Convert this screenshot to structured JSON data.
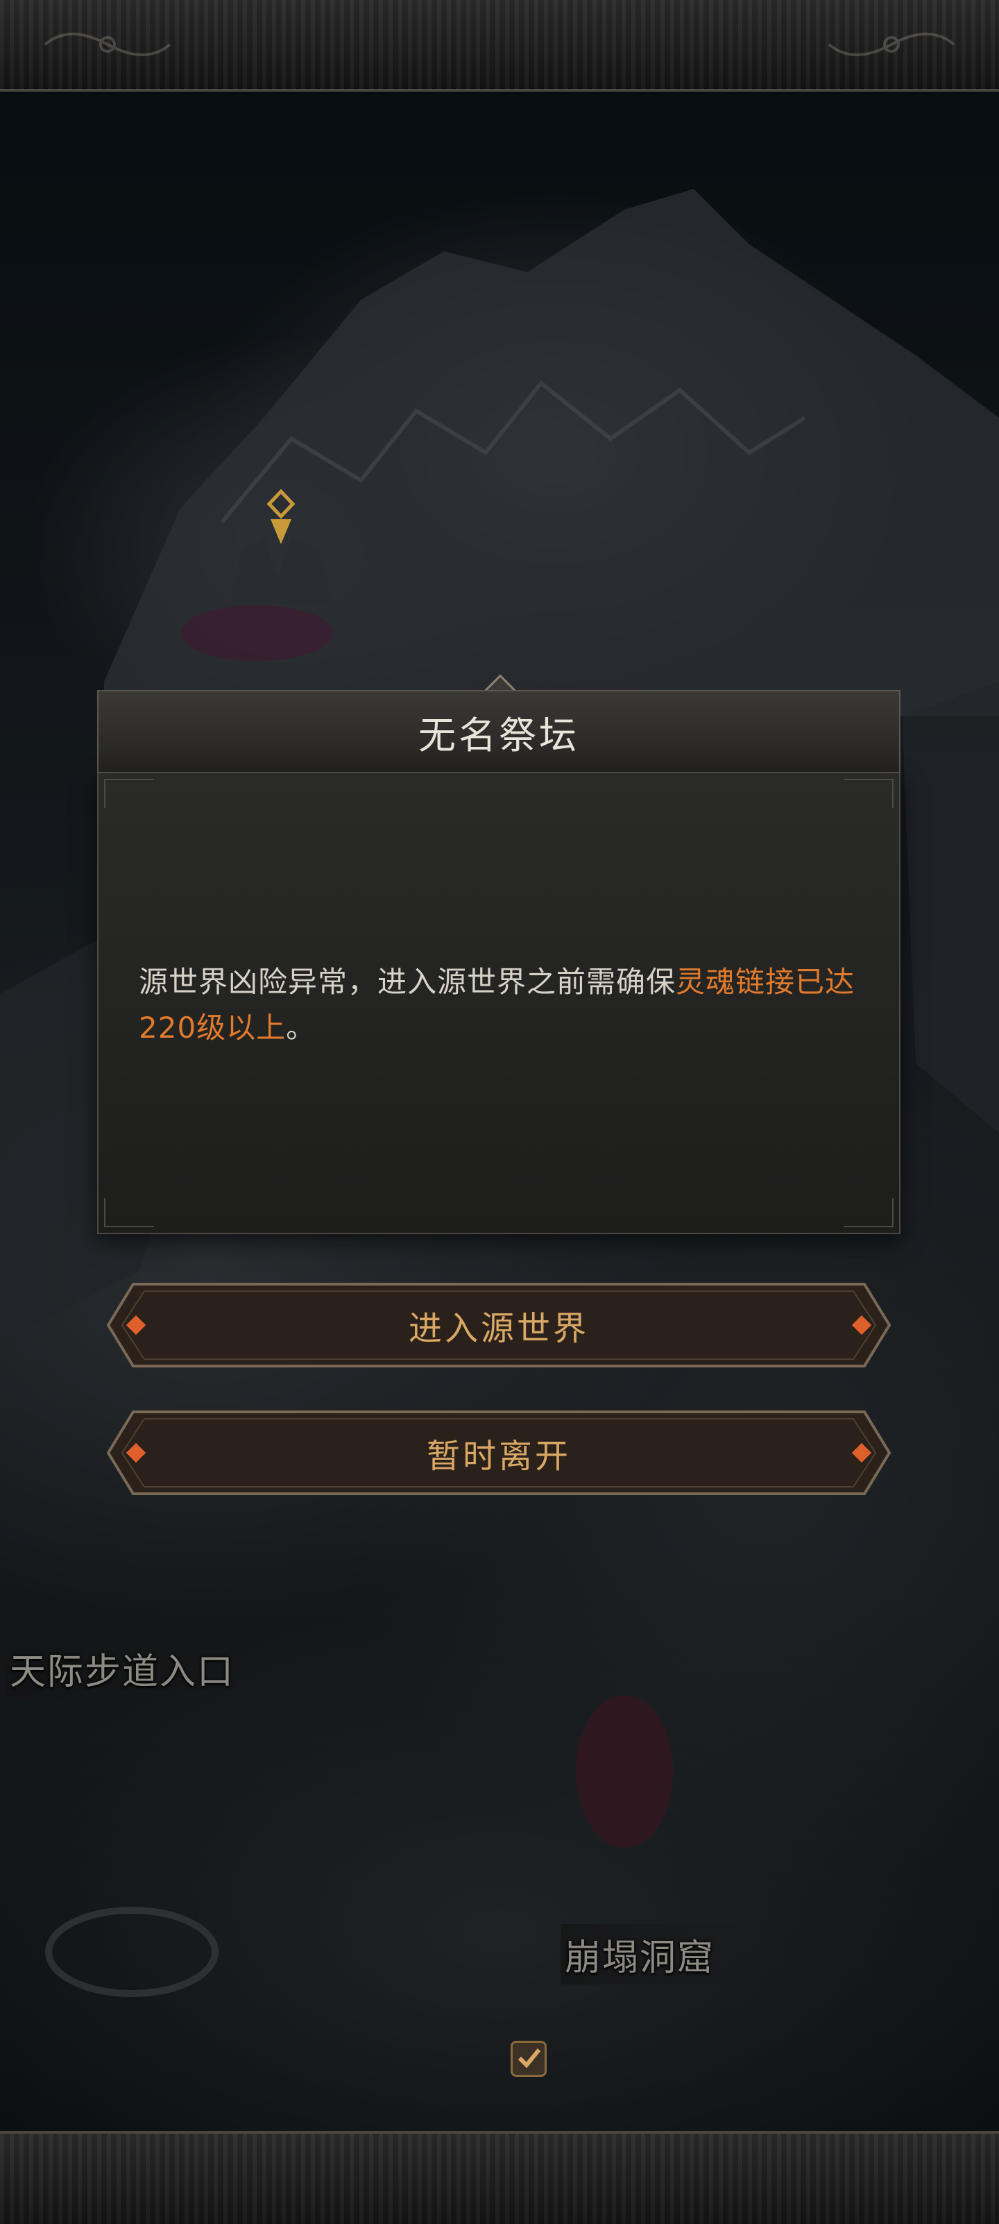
{
  "map": {
    "label_skyway_entrance": "天际步道入口",
    "label_collapsed_cave": "崩塌洞窟"
  },
  "dialog": {
    "title": "无名祭坛",
    "message_part1": "源世界凶险异常，进入源世界之前需确保",
    "message_highlight": "灵魂链接已达220级以上",
    "message_end": "。"
  },
  "buttons": {
    "enter_label": "进入源世界",
    "leave_label": "暂时离开"
  },
  "colors": {
    "highlight": "#e07a2c",
    "button_text": "#d9a866",
    "title_text": "#e9e4da"
  },
  "icons": {
    "waypoint": "waypoint-marker-icon",
    "check": "check-icon"
  }
}
